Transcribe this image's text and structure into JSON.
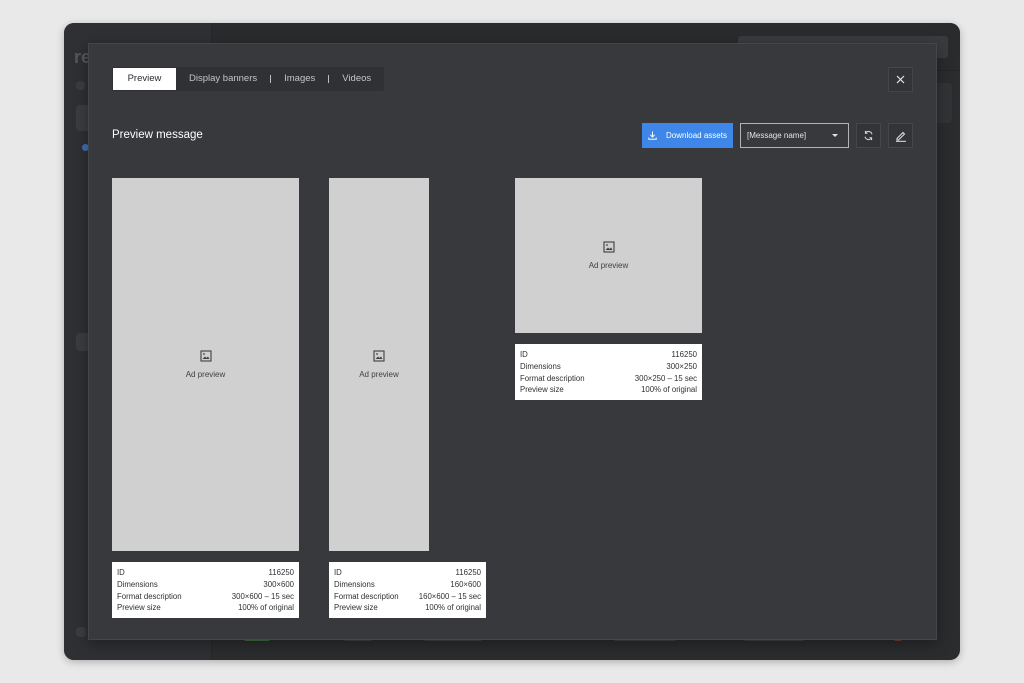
{
  "background_app": {
    "logo_text": "re"
  },
  "modal": {
    "tabs": [
      {
        "label": "Preview",
        "active": true
      },
      {
        "label": "Display banners",
        "active": false
      },
      {
        "label": "Images",
        "active": false
      },
      {
        "label": "Videos",
        "active": false
      }
    ],
    "title": "Preview message",
    "download_label": "Download assets",
    "select_value": "[Message name]",
    "icons": {
      "close": "close-icon",
      "download": "download-icon",
      "refresh": "refresh-icon",
      "edit": "edit-icon",
      "ad": "image-icon"
    },
    "colors": {
      "accent": "#3e86e8",
      "modal_bg": "#38393c",
      "placeholder": "#d0d0d0"
    },
    "previews": [
      {
        "label": "Ad preview",
        "info": {
          "id_label": "ID",
          "id": "116250",
          "dimensions_label": "Dimensions",
          "dimensions": "300×600",
          "format_label": "Format description",
          "format": "300×600 – 15 sec",
          "size_label": "Preview size",
          "size": "100% of original"
        }
      },
      {
        "label": "Ad preview",
        "info": {
          "id_label": "ID",
          "id": "116250",
          "dimensions_label": "Dimensions",
          "dimensions": "160×600",
          "format_label": "Format description",
          "format": "160×600 – 15 sec",
          "size_label": "Preview size",
          "size": "100% of original"
        }
      },
      {
        "label": "Ad preview",
        "info": {
          "id_label": "ID",
          "id": "116250",
          "dimensions_label": "Dimensions",
          "dimensions": "300×250",
          "format_label": "Format description",
          "format": "300×250 – 15 sec",
          "size_label": "Preview size",
          "size": "100% of original"
        }
      }
    ]
  }
}
